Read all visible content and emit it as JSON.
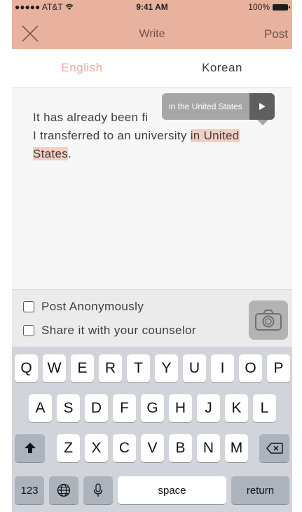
{
  "status_bar": {
    "carrier": "●●●●● AT&T",
    "time": "9:41 AM",
    "battery": "100%"
  },
  "nav": {
    "title": "Write",
    "post_label": "Post"
  },
  "tabs": [
    {
      "label": "English",
      "active": true
    },
    {
      "label": "Korean",
      "active": false
    }
  ],
  "editor": {
    "line1": "It has already been fi",
    "line2_prefix": "I transferred to an university ",
    "line2_highlight": "in United",
    "line3_highlight": "States",
    "line3_suffix": "."
  },
  "tooltip": {
    "suggestion": "in the United States"
  },
  "options": {
    "anonymous_label": "Post Anonymously",
    "share_label": "Share it with your counselor"
  },
  "keyboard": {
    "row1": [
      "Q",
      "W",
      "E",
      "R",
      "T",
      "Y",
      "U",
      "I",
      "O",
      "P"
    ],
    "row2": [
      "A",
      "S",
      "D",
      "F",
      "G",
      "H",
      "J",
      "K",
      "L"
    ],
    "row3": [
      "Z",
      "X",
      "C",
      "V",
      "B",
      "N",
      "M"
    ],
    "numbers_label": "123",
    "space_label": "space",
    "return_label": "return"
  },
  "colors": {
    "accent": "#e9b29f",
    "active_tab": "#e7ab97",
    "highlight": "#f1cfc3"
  }
}
